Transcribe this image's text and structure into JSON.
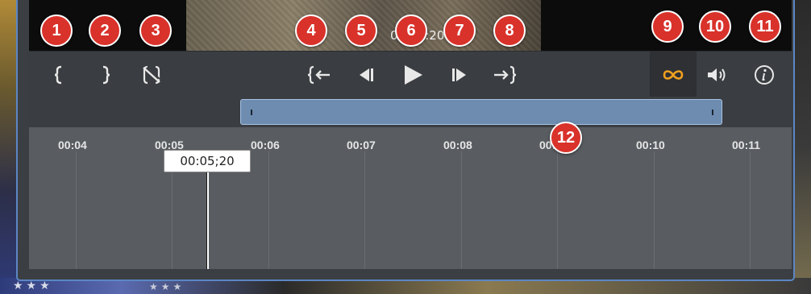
{
  "overlay_timecode": "00:05:20",
  "toolbar": {
    "mark_in": {
      "icon": "mark-in-icon"
    },
    "mark_out": {
      "icon": "mark-out-icon"
    },
    "clear_marks": {
      "icon": "clear-marks-icon"
    },
    "go_to_in": {
      "icon": "go-to-in-icon"
    },
    "step_back": {
      "icon": "step-back-icon"
    },
    "play": {
      "icon": "play-icon"
    },
    "step_forward": {
      "icon": "step-forward-icon"
    },
    "go_to_out": {
      "icon": "go-to-out-icon"
    },
    "loop": {
      "icon": "loop-icon",
      "color": "#f0a020",
      "active": true
    },
    "volume": {
      "icon": "volume-icon"
    },
    "info": {
      "icon": "info-icon"
    }
  },
  "timeline": {
    "ticks": [
      "00:04",
      "00:05",
      "00:06",
      "00:07",
      "00:08",
      "00:09",
      "00:10",
      "00:11"
    ],
    "playhead_time": "00:05;20"
  },
  "callouts": [
    "1",
    "2",
    "3",
    "4",
    "5",
    "6",
    "7",
    "8",
    "9",
    "10",
    "11",
    "12"
  ],
  "colors": {
    "accent": "#5c86c4",
    "loop_active": "#f0a020",
    "callout": "#d8322a",
    "range": "#6d8cb0"
  }
}
